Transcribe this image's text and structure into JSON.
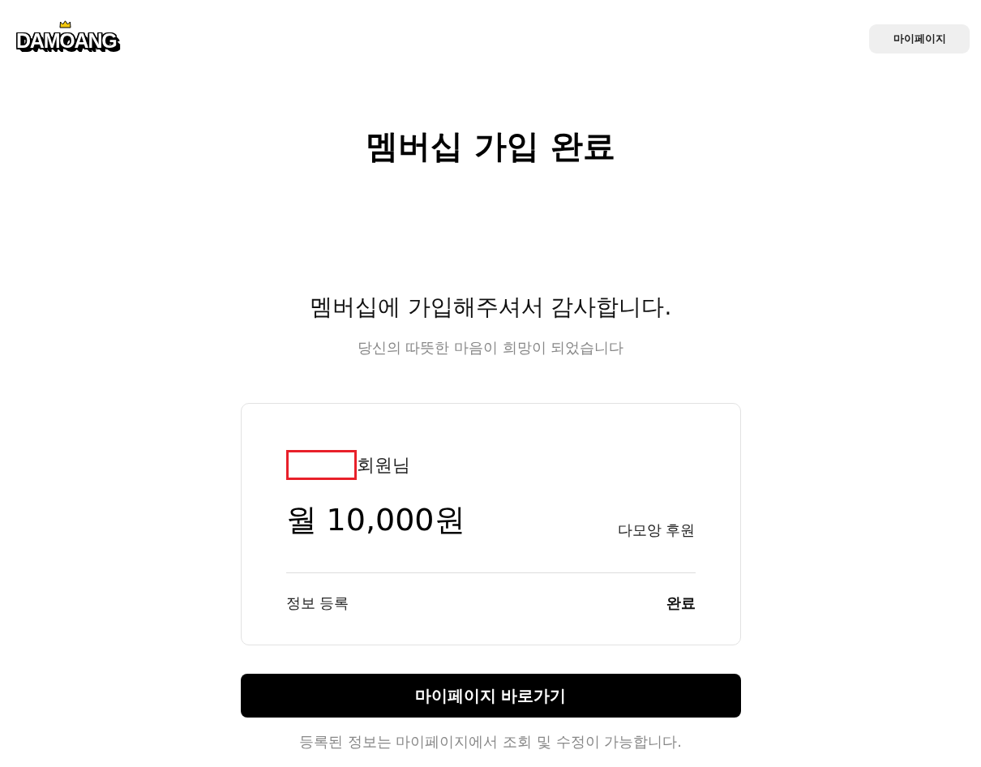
{
  "header": {
    "logo": {
      "text": "DAMOANG"
    },
    "mypage_button": "마이페이지"
  },
  "title": "멤버십 가입 완료",
  "thanks": {
    "heading": "멤버십에 가입해주셔서 감사합니다.",
    "subheading": "당신의 따뜻한 마음이 희망이 되었습니다"
  },
  "summary_card": {
    "member": {
      "name_redacted": true,
      "suffix": "회원님"
    },
    "amount": "월 10,000원",
    "plan": "다모앙 후원",
    "rows": [
      {
        "label": "정보 등록",
        "value": "완료"
      }
    ]
  },
  "primary_button": "마이페이지 바로가기",
  "note": "등록된 정보는 마이페이지에서 조회 및 수정이 가능합니다."
}
